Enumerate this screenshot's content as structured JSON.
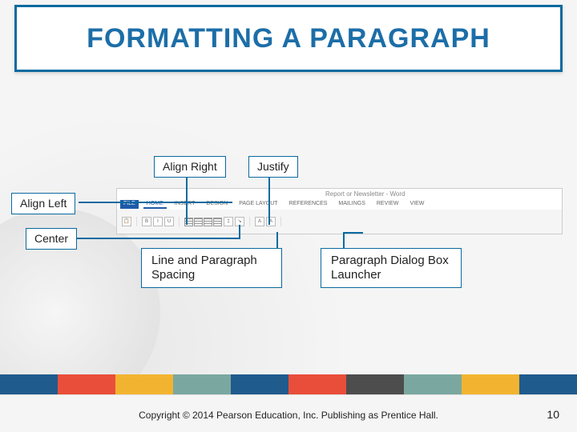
{
  "title": "FORMATTING A PARAGRAPH",
  "callouts": {
    "align_right": "Align Right",
    "justify": "Justify",
    "align_left": "Align Left",
    "center": "Center",
    "spacing": "Line and Paragraph Spacing",
    "launcher": "Paragraph Dialog Box Launcher"
  },
  "ribbon": {
    "window_title": "Report or Newsletter - Word",
    "tabs": [
      "FILE",
      "HOME",
      "INSERT",
      "DESIGN",
      "PAGE LAYOUT",
      "REFERENCES",
      "MAILINGS",
      "REVIEW",
      "VIEW"
    ],
    "active_tab": "HOME"
  },
  "band_colors": [
    "#205b8d",
    "#e94e3a",
    "#f2b430",
    "#7aa8a0",
    "#205b8d",
    "#e94e3a",
    "#4d4d4d",
    "#7aa8a0",
    "#f2b430",
    "#205b8d"
  ],
  "footer": {
    "copyright": "Copyright © 2014 Pearson Education, Inc. Publishing as Prentice Hall.",
    "page": "10"
  }
}
